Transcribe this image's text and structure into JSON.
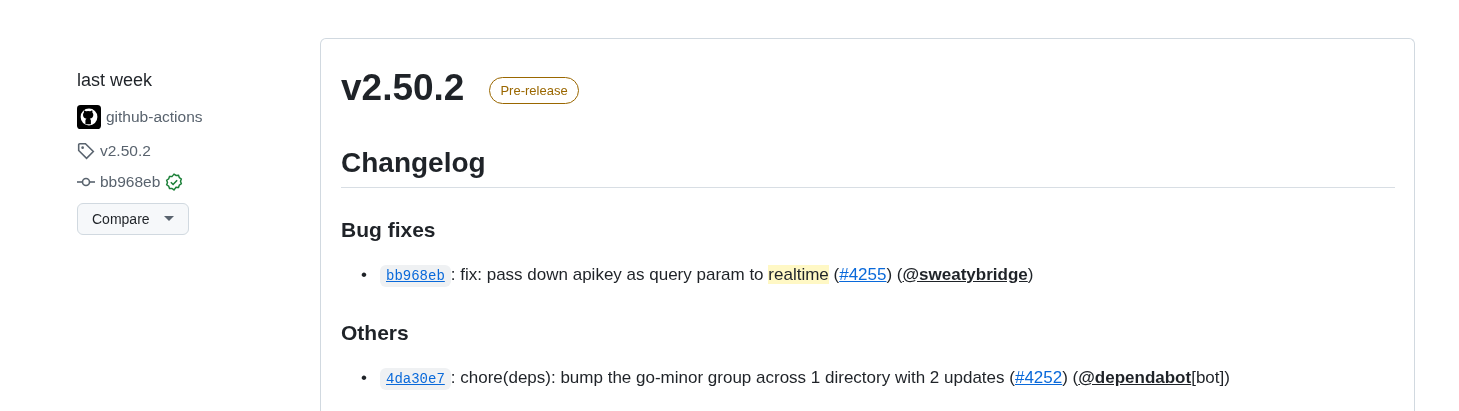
{
  "sidebar": {
    "date": "last week",
    "author": "github-actions",
    "tag": "v2.50.2",
    "commit": "bb968eb",
    "verified": true,
    "compare_button": "Compare"
  },
  "release": {
    "title": "v2.50.2",
    "badge": "Pre-release",
    "heading": "Changelog",
    "sections": [
      {
        "title": "Bug fixes",
        "items": [
          {
            "bullet": "•",
            "commit": "bb968eb",
            "segments": [
              {
                "kind": "text",
                "text": ": fix: pass down apikey as query param to "
              },
              {
                "kind": "highlight",
                "text": "realtime"
              },
              {
                "kind": "text",
                "text": " ("
              },
              {
                "kind": "link",
                "text": "#4255"
              },
              {
                "kind": "text",
                "text": ") ("
              },
              {
                "kind": "mention",
                "text": "@sweatybridge"
              },
              {
                "kind": "text",
                "text": ")"
              }
            ]
          }
        ]
      },
      {
        "title": "Others",
        "items": [
          {
            "bullet": "•",
            "commit": "4da30e7",
            "segments": [
              {
                "kind": "text",
                "text": ": chore(deps): bump the go-minor group across 1 directory with 2 updates ("
              },
              {
                "kind": "link",
                "text": "#4252"
              },
              {
                "kind": "text",
                "text": ") ("
              },
              {
                "kind": "mention",
                "text": "@dependabot"
              },
              {
                "kind": "text",
                "text": "[bot])"
              }
            ]
          }
        ]
      }
    ]
  }
}
